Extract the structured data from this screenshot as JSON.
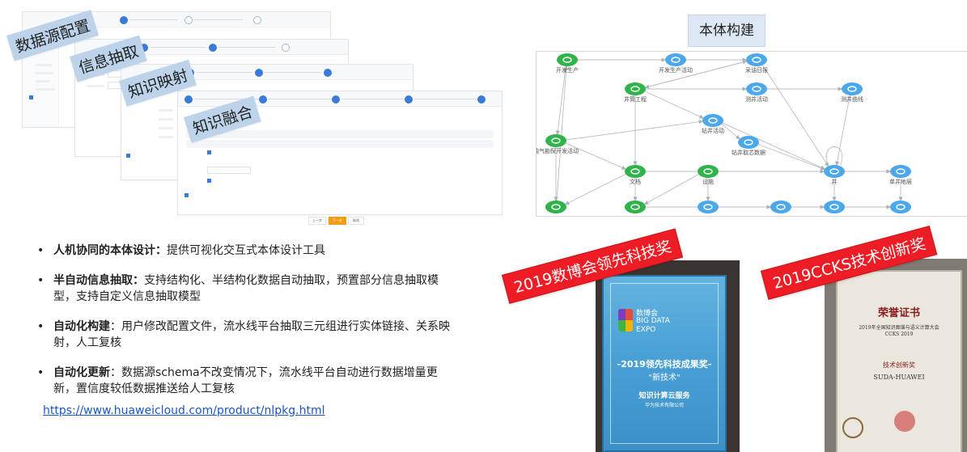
{
  "screens": {
    "labels": [
      "数据源配置",
      "信息抽取",
      "知识映射",
      "知识融合"
    ],
    "prev_button": "上一步",
    "next_button": "下一步",
    "cancel_button": "取消"
  },
  "graph": {
    "title": "本体构建",
    "nodes": [
      {
        "label": "开发生产",
        "color": "green"
      },
      {
        "label": "开发生产活动",
        "color": "blue"
      },
      {
        "label": "采油日报",
        "color": "blue"
      },
      {
        "label": "井筒工程",
        "color": "green"
      },
      {
        "label": "测井活动",
        "color": "blue"
      },
      {
        "label": "测井曲线",
        "color": "blue"
      },
      {
        "label": "钻井活动",
        "color": "blue"
      },
      {
        "label": "油气勘探开发活动",
        "color": "green"
      },
      {
        "label": "钻井取芯数据",
        "color": "blue"
      },
      {
        "label": "文档",
        "color": "green"
      },
      {
        "label": "设施",
        "color": "green"
      },
      {
        "label": "井",
        "color": "blue"
      },
      {
        "label": "单井地层",
        "color": "blue"
      },
      {
        "label": "",
        "color": "green"
      },
      {
        "label": "",
        "color": "green"
      },
      {
        "label": "",
        "color": "blue"
      },
      {
        "label": "",
        "color": "blue"
      },
      {
        "label": "",
        "color": "blue"
      },
      {
        "label": "",
        "color": "blue"
      }
    ],
    "colors": {
      "green": "#2fb34a",
      "blue": "#4ba8ea"
    }
  },
  "bullets": [
    {
      "head": "人机协同的本体设计：",
      "text": "提供可视化交互式本体设计工具"
    },
    {
      "head": "半自动信息抽取：",
      "text": "支持结构化、半结构化数据自动抽取，预置部分信息抽取模型，支持自定义信息抽取模型"
    },
    {
      "head": "自动化构建",
      "text": "：用户修改配置文件，流水线平台抽取三元组进行实体链接、关系映射，人工复核"
    },
    {
      "head": "自动化更新",
      "text": "：数据源schema不改变情况下，流水线平台自动进行数据增量更新，置信度较低数据推送给人工复核"
    }
  ],
  "link": "https://www.huaweicloud.com/product/nlpkg.html",
  "awards": {
    "banner_1": "2019数博会领先科技奖",
    "banner_2": "2019CCKS技术创新奖",
    "plaque": {
      "logo_cn": "数博会",
      "logo_en1": "BIG DATA",
      "logo_en2": "EXPO",
      "title": "-2019领先科技成果奖-",
      "subtitle": "\"新技术\"",
      "product": "知识计算云服务",
      "company": "华为技术有限公司"
    },
    "certificate": {
      "title": "荣誉证书",
      "conference": "2019年全国知识图谱与语义计算大会",
      "event": "CCKS 2019",
      "award": "技术创新奖",
      "team": "SUDA-HUAWEI"
    }
  },
  "accent_colors": {
    "tag_bg": "#bcd3ea",
    "banner_red": "#ee1c24",
    "link_blue": "#1a56c4"
  }
}
